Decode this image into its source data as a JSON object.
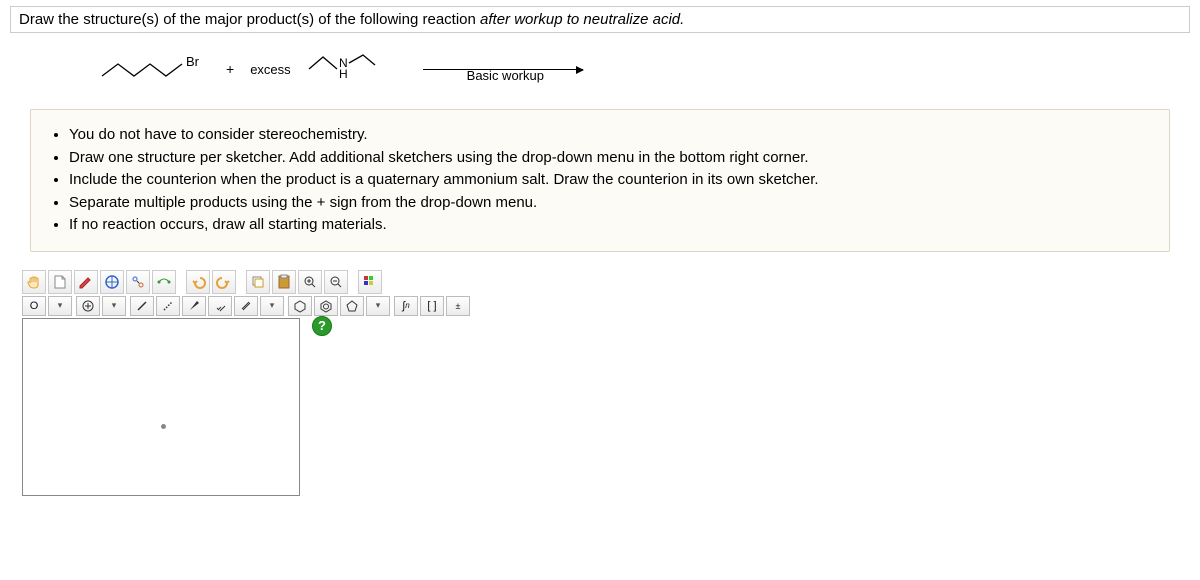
{
  "question": {
    "prefix": "Draw the structure(s) of the major product(s) of the following reaction ",
    "italic": "after workup to neutralize acid."
  },
  "reaction": {
    "reagent1_label": "Br",
    "plus": "+",
    "excess": "excess",
    "amine_top": "N",
    "amine_bottom": "H",
    "arrow_label": "Basic workup"
  },
  "instructions": [
    "You do not have to consider stereochemistry.",
    "Draw one structure per sketcher. Add additional sketchers using the drop-down menu in the bottom right corner.",
    "Include the counterion when the product is a quaternary ammonium salt. Draw the counterion in its own sketcher.",
    "Separate multiple products using the + sign from the drop-down menu.",
    "If no reaction occurs, draw all starting materials."
  ],
  "toolbar1": {
    "hand": "✋",
    "open": "open",
    "edit": "✎",
    "move": "✥",
    "zoomfit": "⤢",
    "clean": "clean",
    "undo": "↶",
    "redo": "↷",
    "copy2": "copy",
    "paste": "paste",
    "zoomin": "⊕",
    "zoomout": "⊖",
    "color": "color"
  },
  "toolbar2": {
    "atom_o": "O",
    "dd1": "▾",
    "add": "⊕",
    "dd2": "▾",
    "single": "/",
    "dotted": "⋰",
    "wedge": "▰",
    "hash": "▨",
    "double": "‖",
    "dd3": "▾",
    "ring1": "⬡",
    "ring2": "⬡",
    "ring3": "⬠",
    "dd4": "▾",
    "int_n": "∫n",
    "bracket": "[ ]",
    "charge": "±"
  },
  "help": "?"
}
